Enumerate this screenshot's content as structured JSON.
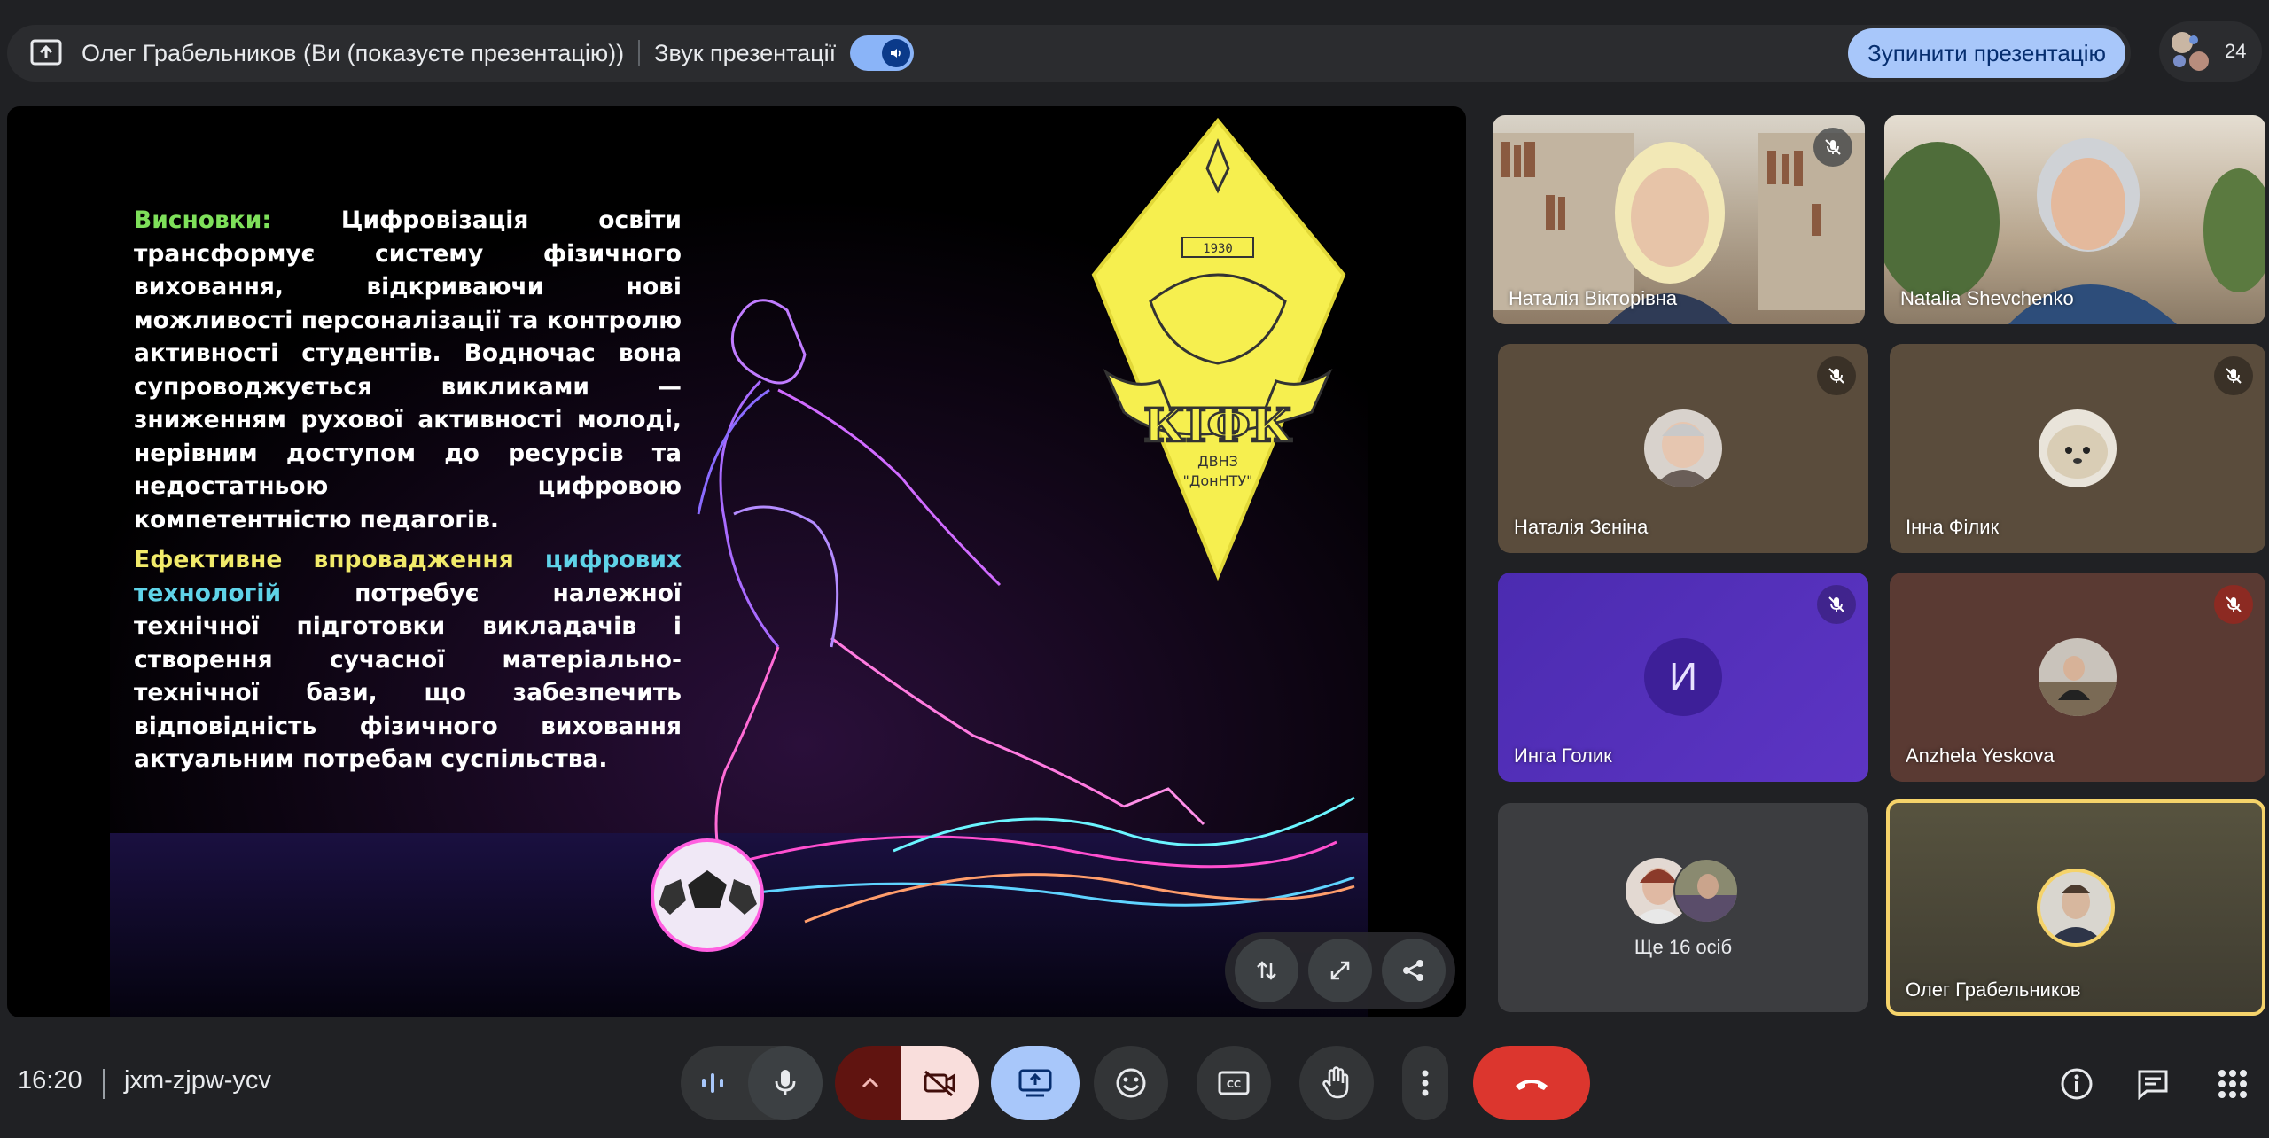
{
  "topbar": {
    "presenter_text": "Олег Грабельников (Ви (показуєте презентацію))",
    "sound_label": "Звук презентації",
    "stop_button": "Зупинити презентацію",
    "participants_count": "24"
  },
  "slide": {
    "p1_label": "Висновки:",
    "p1_text": " Цифровізація освіти трансформує систему фізичного виховання, відкриваючи нові можливості персоналізації та контролю активності студентів. Водночас вона супроводжується викликами — зниженням рухової активності молоді, нерівним доступом до ресурсів та недостатньою цифровою компетентністю педагогів.",
    "p2_label1": "Ефективне впровадження ",
    "p2_label2": "цифрових технологій",
    "p2_text": " потребує належної технічної підготовки викладачів і створення сучасної матеріально-технічної бази, що забезпечить відповідність фізичного виховання актуальним потребам суспільства.",
    "logo_main": "КІФК",
    "logo_sub1": "ДВНЗ",
    "logo_sub2": "\"ДонНТУ\"",
    "logo_year": "1930"
  },
  "participants": [
    {
      "name": "Наталія Вікторівна",
      "muted": true,
      "color": "#8d7a65"
    },
    {
      "name": "Natalia Shevchenko",
      "muted": false,
      "color": "#8a7a66"
    },
    {
      "name": "Наталія Зєніна",
      "muted": true,
      "color": "#5a4c3c"
    },
    {
      "name": "Інна Філик",
      "muted": true,
      "color": "#5a4c3c"
    },
    {
      "name": "Инга Голик",
      "initial": "И",
      "muted": true,
      "color": "#5d35c4"
    },
    {
      "name": "Anzhela Yeskova",
      "muted": true,
      "color": "#5a3a33"
    },
    {
      "name": "Ще 16 осіб",
      "color": "#3c3d40"
    },
    {
      "name": "Олег Грабельников",
      "muted": false,
      "color": "#4a4739",
      "accent": "#f5d36a"
    }
  ],
  "bottom": {
    "time": "16:20",
    "meeting_code": "jxm-zjpw-ycv"
  },
  "colors": {
    "accent_blue": "#a8c7fa",
    "end_call_red": "#dc362e",
    "camera_off_bg": "#f9dedc"
  }
}
